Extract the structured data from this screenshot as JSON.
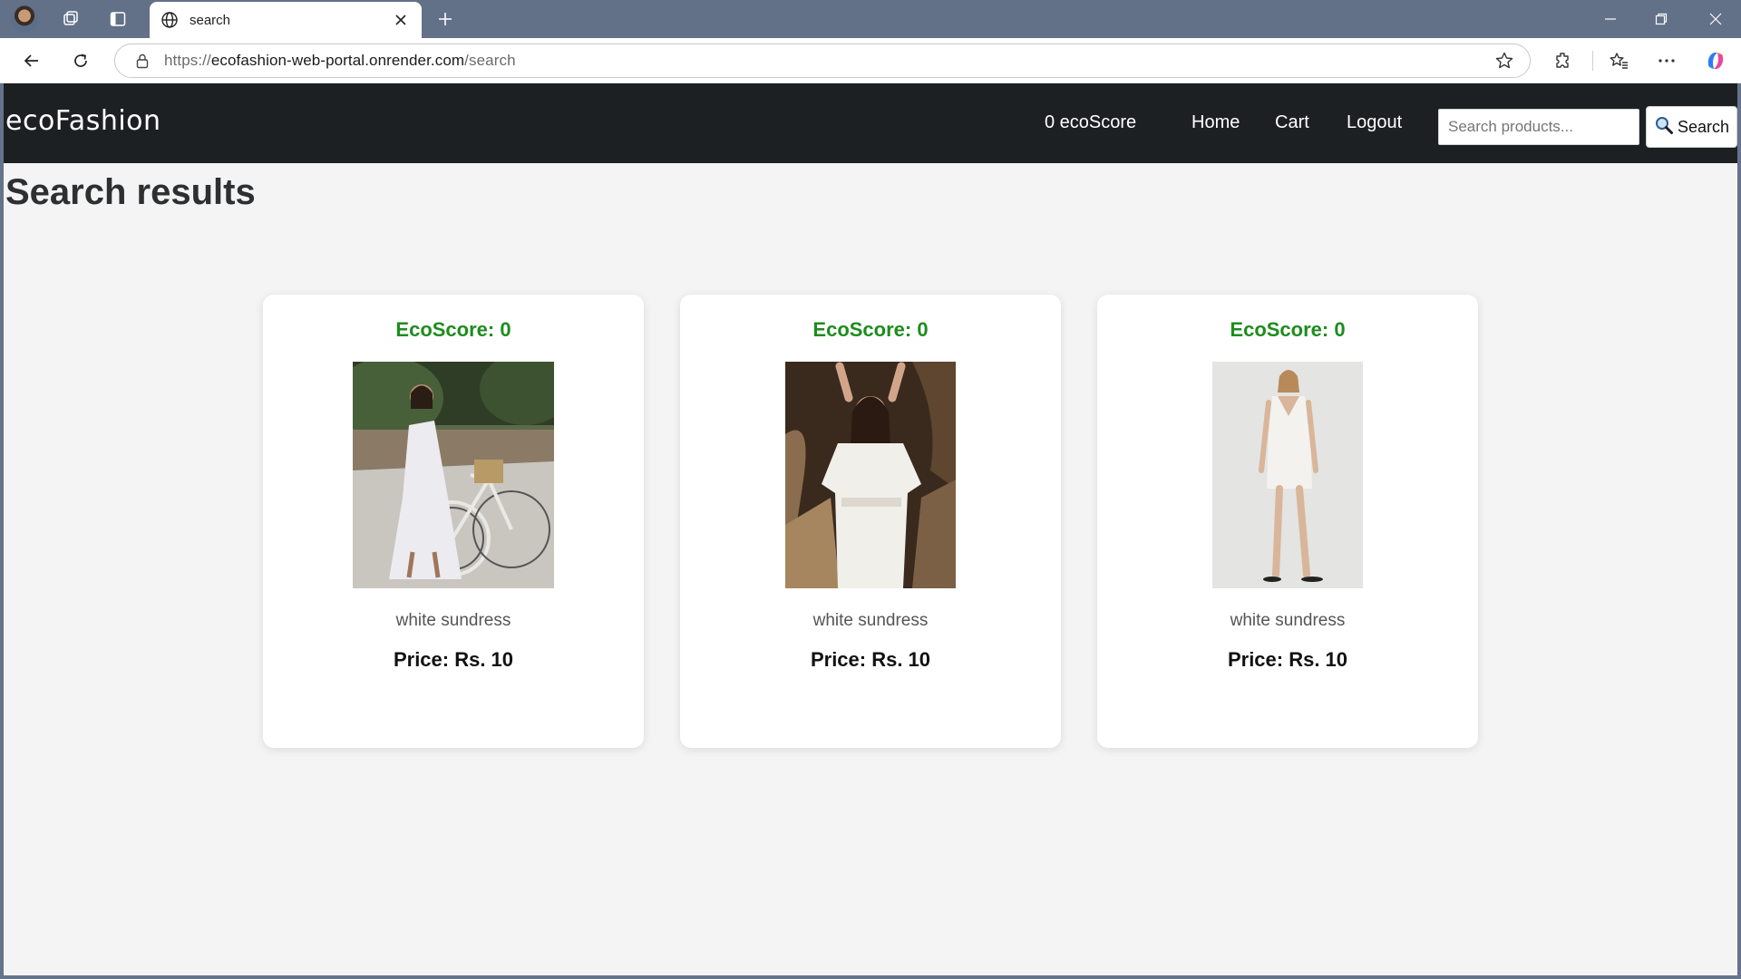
{
  "browser": {
    "tab_title": "search",
    "url_scheme": "https://",
    "url_host": "ecofashion-web-portal.onrender.com",
    "url_path": "/search"
  },
  "site": {
    "brand": "ecoFashion",
    "eco_score": "0 ecoScore",
    "nav": {
      "home": "Home",
      "cart": "Cart",
      "logout": "Logout"
    },
    "search": {
      "placeholder": "Search products...",
      "value": "",
      "button_label": "Search"
    }
  },
  "page": {
    "title": "Search results"
  },
  "products": [
    {
      "eco_score": "EcoScore: 0",
      "name": "white sundress",
      "price": "Price: Rs. 10",
      "image": "woman-with-bicycle-white-dress"
    },
    {
      "eco_score": "EcoScore: 0",
      "name": "white sundress",
      "price": "Price: Rs. 10",
      "image": "woman-against-rock-white-dress"
    },
    {
      "eco_score": "EcoScore: 0",
      "name": "white sundress",
      "price": "Price: Rs. 10",
      "image": "woman-studio-white-mini-dress"
    }
  ],
  "colors": {
    "navbar": "#1d2022",
    "eco_green": "#1e8c1e",
    "page_bg": "#f4f4f4",
    "browser_frame": "#627088"
  }
}
